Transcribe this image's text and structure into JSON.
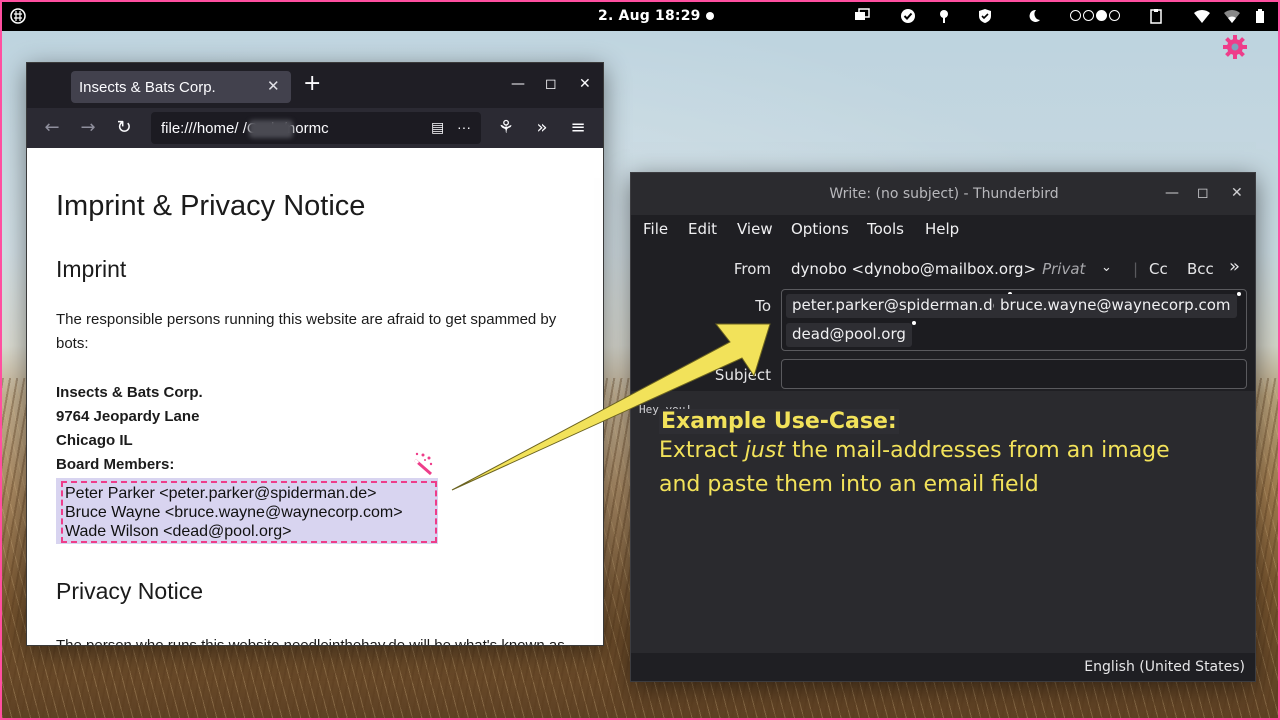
{
  "topbar": {
    "clock": "2. Aug  18:29"
  },
  "browser": {
    "tab_title": "Insects & Bats Corp.",
    "url": "file:///home/       /Code/normc",
    "page": {
      "h1": "Imprint & Privacy Notice",
      "h2_imprint": "Imprint",
      "intro": "The responsible persons running this website are afraid to get spammed by bots:",
      "company": "Insects & Bats Corp.",
      "street": "9764 Jeopardy Lane",
      "city": "Chicago IL",
      "board_label": "Board Members:",
      "members": [
        "Peter Parker <peter.parker@spiderman.de>",
        "Bruce Wayne <bruce.wayne@waynecorp.com>",
        "Wade Wilson <dead@pool.org>"
      ],
      "h2_privacy": "Privacy Notice",
      "privacy_text": "The person who runs this website needleinthehay.de will be what's known as"
    }
  },
  "thunderbird": {
    "title": "Write: (no subject) - Thunderbird",
    "menu": [
      "File",
      "Edit",
      "View",
      "Options",
      "Tools",
      "Help"
    ],
    "from_label": "From",
    "from_value": "dynobo <dynobo@mailbox.org>",
    "from_identity": "Privat",
    "cc_label": "Cc",
    "bcc_label": "Bcc",
    "to_label": "To",
    "recipients": [
      "peter.parker@spiderman.de",
      "bruce.wayne@waynecorp.com",
      "dead@pool.org"
    ],
    "subject_label": "Subject",
    "subject_value": "",
    "body_text": "Hey you!",
    "status_language": "English (United States)"
  },
  "annotation": {
    "heading": "Example Use-Case:",
    "line1_pre": "Extract ",
    "line1_em": "just",
    "line1_post": " the mail-addresses from an image",
    "line2": "and paste them into an email field"
  },
  "colors": {
    "accent_pink": "#ee3d8a",
    "arrow_yellow": "#f2e25a",
    "note_yellow": "#f2e25a"
  }
}
